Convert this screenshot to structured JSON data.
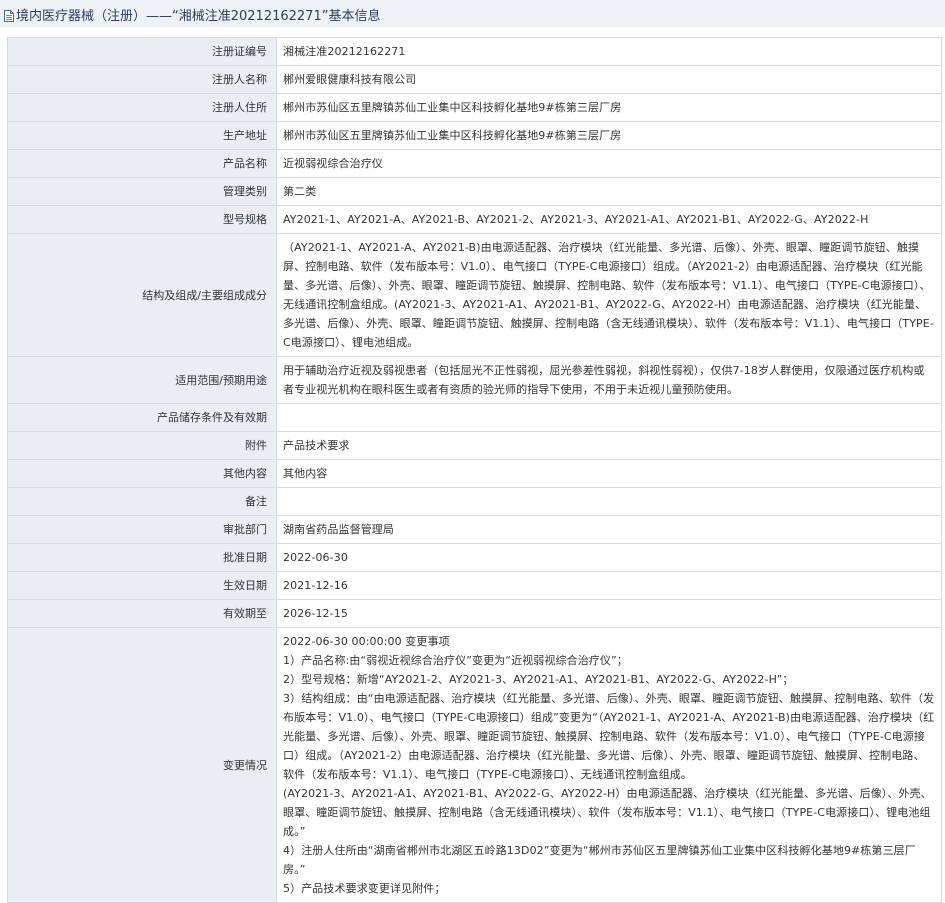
{
  "header": {
    "title": "境内医疗器械（注册）——“湘械注准20212162271”基本信息"
  },
  "rows": [
    {
      "label": "注册证编号",
      "value": "湘械注准20212162271"
    },
    {
      "label": "注册人名称",
      "value": "郴州爱眼健康科技有限公司"
    },
    {
      "label": "注册人住所",
      "value": "郴州市苏仙区五里牌镇苏仙工业集中区科技孵化基地9#栋第三层厂房"
    },
    {
      "label": "生产地址",
      "value": "郴州市苏仙区五里牌镇苏仙工业集中区科技孵化基地9#栋第三层厂房"
    },
    {
      "label": "产品名称",
      "value": "近视弱视综合治疗仪"
    },
    {
      "label": "管理类别",
      "value": "第二类"
    },
    {
      "label": "型号规格",
      "value": "AY2021-1、AY2021-A、AY2021-B、AY2021-2、AY2021-3、AY2021-A1、AY2021-B1、AY2022-G、AY2022-H"
    },
    {
      "label": "结构及组成/主要组成成分",
      "value": "（AY2021-1、AY2021-A、AY2021-B)由电源适配器、治疗模块（红光能量、多光谱、后像）、外壳、眼罩、瞳距调节旋钮、触摸屏、控制电路、软件（发布版本号：V1.0）、电气接口（TYPE-C电源接口）组成。（AY2021-2）由电源适配器、治疗模块（红光能量、多光谱、后像）、外壳、眼罩、瞳距调节旋钮、触摸屏、控制电路、软件（发布版本号：V1.1）、电气接口（TYPE-C电源接口）、无线通讯控制盒组成。(AY2021-3、AY2021-A1、AY2021-B1、AY2022-G、AY2022-H）由电源适配器、治疗模块（红光能量、多光谱、后像）、外壳、眼罩、瞳距调节旋钮、触摸屏、控制电路（含无线通讯模块）、软件（发布版本号：V1.1）、电气接口（TYPE-C电源接口）、锂电池组成。"
    },
    {
      "label": "适用范围/预期用途",
      "value": "用于辅助治疗近视及弱视患者（包括屈光不正性弱视，屈光参差性弱视，斜视性弱视），仅供7-18岁人群使用，仅限通过医疗机构或者专业视光机构在眼科医生或者有资质的验光师的指导下使用，不用于未近视儿童预防使用。"
    },
    {
      "label": "产品储存条件及有效期",
      "value": ""
    },
    {
      "label": "附件",
      "value": "产品技术要求"
    },
    {
      "label": "其他内容",
      "value": "其他内容"
    },
    {
      "label": "备注",
      "value": ""
    },
    {
      "label": "审批部门",
      "value": "湖南省药品监督管理局"
    },
    {
      "label": "批准日期",
      "value": "2022-06-30"
    },
    {
      "label": "生效日期",
      "value": "2021-12-16"
    },
    {
      "label": "有效期至",
      "value": "2026-12-15"
    }
  ],
  "changes": {
    "label": "变更情况",
    "lines": [
      "2022-06-30 00:00:00 变更事项",
      "1）产品名称:由“弱视近视综合治疗仪”变更为“近视弱视综合治疗仪”；",
      "2）型号规格：新增“AY2021-2、AY2021-3、AY2021-A1、AY2021-B1、AY2022-G、AY2022-H”；",
      "3）结构组成：由“由电源适配器、治疗模块（红光能量、多光谱、后像）、外壳、眼罩、瞳距调节旋钮、触摸屏、控制电路、软件（发布版本号：V1.0）、电气接口（TYPE-C电源接口）组成”变更为“（AY2021-1、AY2021-A、AY2021-B)由电源适配器、治疗模块（红光能量、多光谱、后像）、外壳、眼罩、瞳距调节旋钮、触摸屏、控制电路、软件（发布版本号：V1.0）、电气接口（TYPE-C电源接口）组成。（AY2021-2）由电源适配器、治疗模块（红光能量、多光谱、后像）、外壳、眼罩、瞳距调节旋钮、触摸屏、控制电路、软件（发布版本号：V1.1）、电气接口（TYPE-C电源接口）、无线通讯控制盒组成。",
      "(AY2021-3、AY2021-A1、AY2021-B1、AY2022-G、AY2022-H）由电源适配器、治疗模块（红光能量、多光谱、后像）、外壳、眼罩、瞳距调节旋钮、触摸屏、控制电路（含无线通讯模块）、软件（发布版本号：V1.1）、电气接口（TYPE-C电源接口）、锂电池组成。”",
      "4）注册人住所由“湖南省郴州市北湖区五岭路13D02”变更为“郴州市苏仙区五里牌镇苏仙工业集中区科技孵化基地9#栋第三层厂房。”",
      "5）产品技术要求变更详见附件；"
    ]
  }
}
